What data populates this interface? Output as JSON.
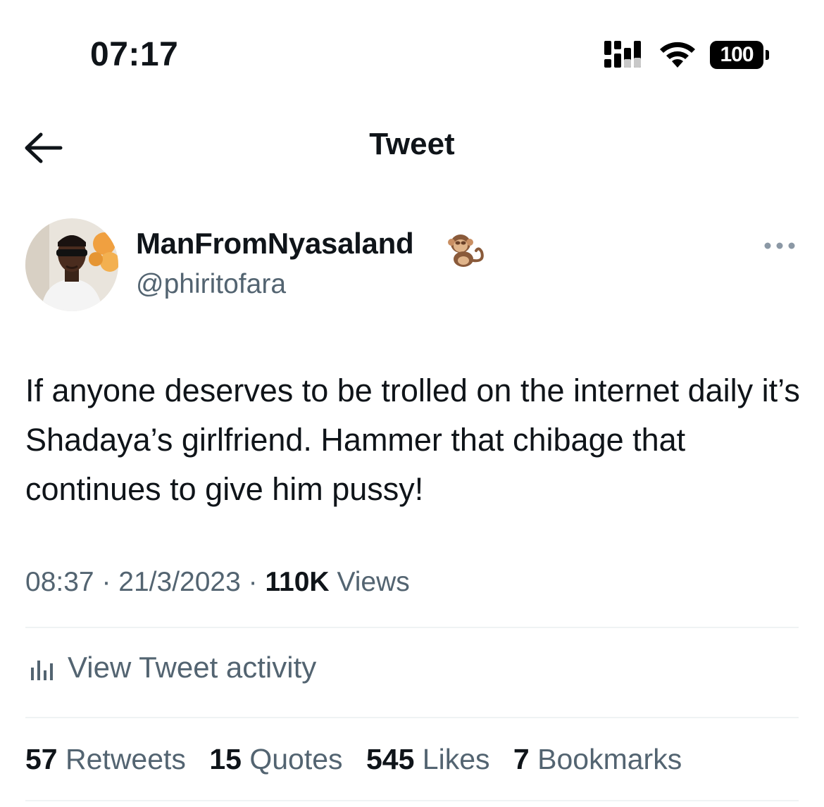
{
  "status_bar": {
    "time": "07:17",
    "battery": "100",
    "icons": [
      "cellular-signal-icon",
      "wifi-icon",
      "battery-icon"
    ]
  },
  "header": {
    "back_icon": "arrow-left-icon",
    "title": "Tweet"
  },
  "author": {
    "display_name": "ManFromNyasaland",
    "badge_emoji": "monkey-emoji",
    "handle": "@phiritofara",
    "more_icon": "more-horizontal-icon"
  },
  "tweet": {
    "text": "If anyone deserves to be trolled on the internet daily it’s Shadaya’s girlfriend. Hammer that chibage that continues to give him pussy!",
    "time": "08:37",
    "date": "21/3/2023",
    "separator": "·",
    "views_count": "110K",
    "views_label": "Views"
  },
  "activity": {
    "icon": "bar-chart-icon",
    "label": "View Tweet activity"
  },
  "stats": [
    {
      "count": "57",
      "label": "Retweets"
    },
    {
      "count": "15",
      "label": "Quotes"
    },
    {
      "count": "545",
      "label": "Likes"
    },
    {
      "count": "7",
      "label": "Bookmarks"
    }
  ],
  "colors": {
    "text_primary": "#0f1419",
    "text_secondary": "#536471",
    "divider": "#eff3f4",
    "background": "#ffffff"
  }
}
